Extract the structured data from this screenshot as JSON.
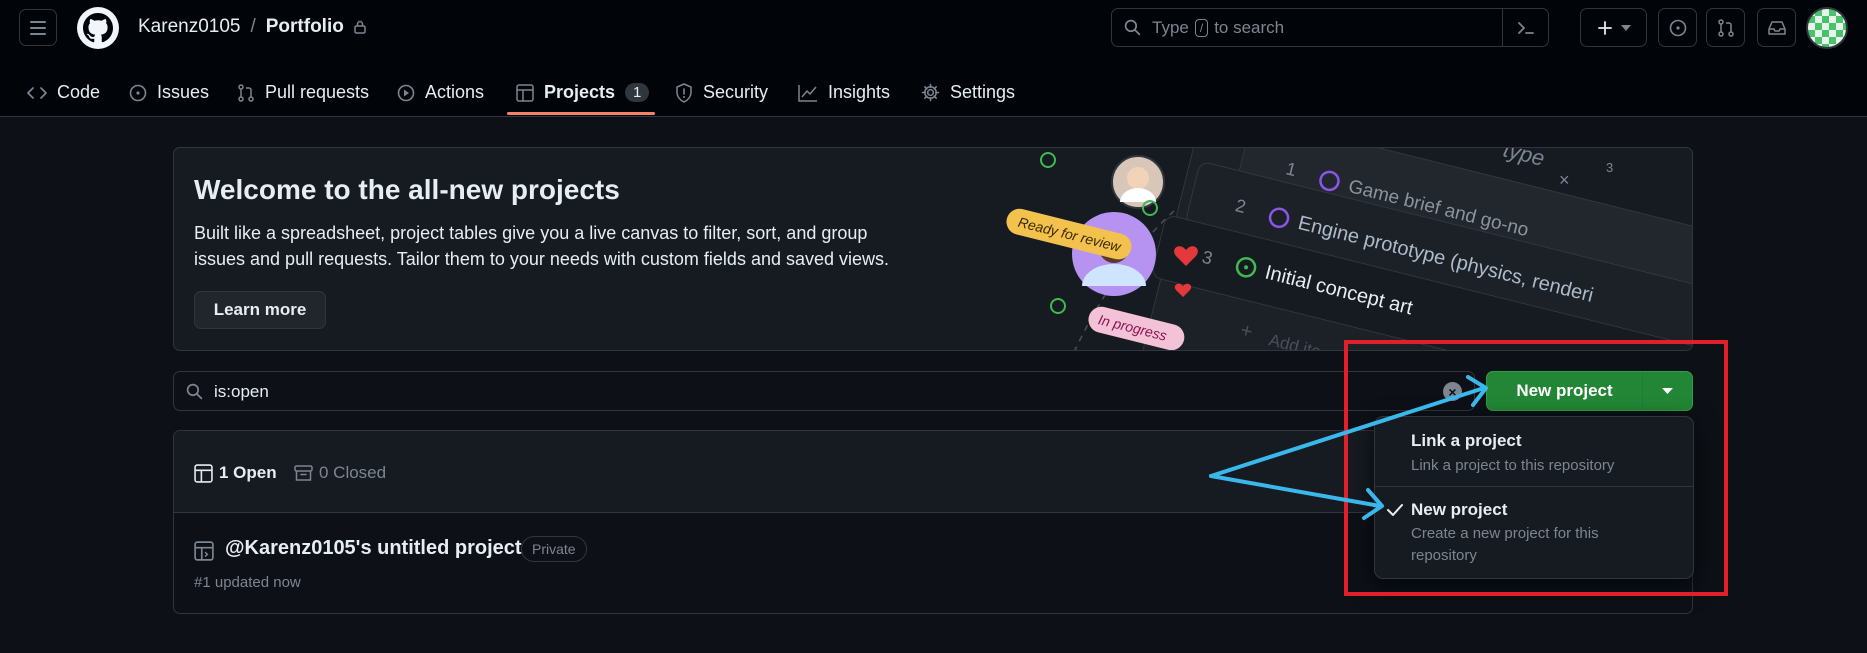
{
  "header": {
    "owner": "Karenz0105",
    "separator": "/",
    "repo": "Portfolio",
    "search_prefix": "Type",
    "search_key": "/",
    "search_suffix": "to search"
  },
  "tabs": [
    {
      "label": "Code",
      "icon": "code-icon"
    },
    {
      "label": "Issues",
      "icon": "issue-icon"
    },
    {
      "label": "Pull requests",
      "icon": "pull-request-icon"
    },
    {
      "label": "Actions",
      "icon": "play-icon"
    },
    {
      "label": "Projects",
      "icon": "table-icon",
      "count": "1",
      "selected": true
    },
    {
      "label": "Security",
      "icon": "shield-icon"
    },
    {
      "label": "Insights",
      "icon": "graph-icon"
    },
    {
      "label": "Settings",
      "icon": "gear-icon"
    }
  ],
  "banner": {
    "title": "Welcome to the all-new projects",
    "description": "Built like a spreadsheet, project tables give you a live canvas to filter, sort, and group issues and pull requests. Tailor them to your needs with custom fields and saved views.",
    "learn_more": "Learn more",
    "illustration": {
      "ready_label": "Ready for review",
      "progress_label": "In progress",
      "rows": [
        {
          "num": "1",
          "text": "Game brief and go-no"
        },
        {
          "num": "2",
          "text": "Engine prototype (physics, renderi"
        },
        {
          "num": "3",
          "text": "Initial concept art"
        }
      ],
      "header_fragment": "type",
      "header_count": "3",
      "add_label": "Add ite"
    }
  },
  "filter": {
    "value": "is:open"
  },
  "new_project_button": "New project",
  "list": {
    "open_label": "1 Open",
    "closed_label": "0 Closed",
    "project": {
      "title": "@Karenz0105's untitled project",
      "visibility": "Private",
      "meta": "#1 updated now"
    }
  },
  "dropdown": {
    "items": [
      {
        "title": "Link a project",
        "description": "Link a project to this repository"
      },
      {
        "title": "New project",
        "description": "Create a new project for this repository",
        "checked": true
      }
    ]
  },
  "colors": {
    "primary_button": "#238636",
    "annotation_box": "#e0202a",
    "annotation_arrow": "#3ab8ec",
    "selected_tab_underline": "#f78166"
  }
}
